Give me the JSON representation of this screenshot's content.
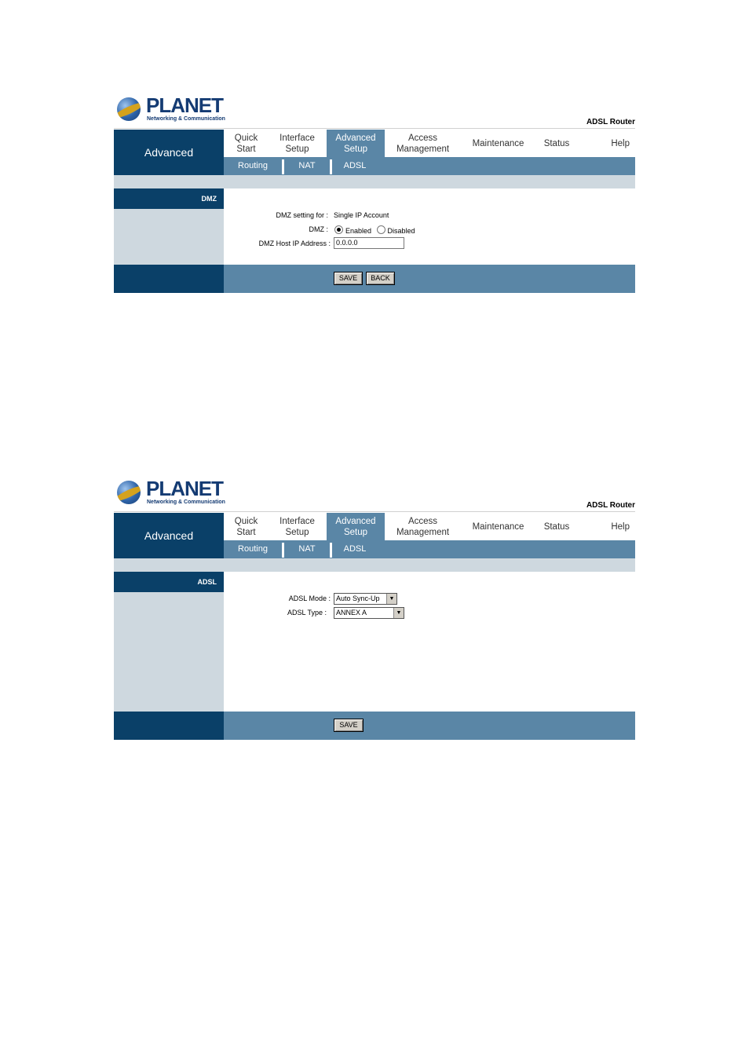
{
  "brand": {
    "name": "PLANET",
    "tagline": "Networking & Communication",
    "product": "ADSL Router"
  },
  "left_title": "Advanced",
  "nav": [
    {
      "label": "Quick\nStart"
    },
    {
      "label": "Interface\nSetup"
    },
    {
      "label": "Advanced\nSetup"
    },
    {
      "label": "Access\nManagement"
    },
    {
      "label": "Maintenance"
    },
    {
      "label": "Status"
    },
    {
      "label": "Help"
    }
  ],
  "subnav": [
    {
      "label": "Routing"
    },
    {
      "label": "NAT"
    },
    {
      "label": "ADSL"
    }
  ],
  "panel1": {
    "section": "DMZ",
    "dmz_setting_label": "DMZ setting for :",
    "dmz_setting_value": "Single IP Account",
    "dmz_label": "DMZ :",
    "enabled_label": "Enabled",
    "disabled_label": "Disabled",
    "selected": "Enabled",
    "host_ip_label": "DMZ Host IP Address :",
    "host_ip_value": "0.0.0.0",
    "save_label": "SAVE",
    "back_label": "BACK"
  },
  "panel2": {
    "section": "ADSL",
    "mode_label": "ADSL Mode :",
    "mode_value": "Auto Sync-Up",
    "type_label": "ADSL Type :",
    "type_value": "ANNEX A",
    "save_label": "SAVE"
  }
}
